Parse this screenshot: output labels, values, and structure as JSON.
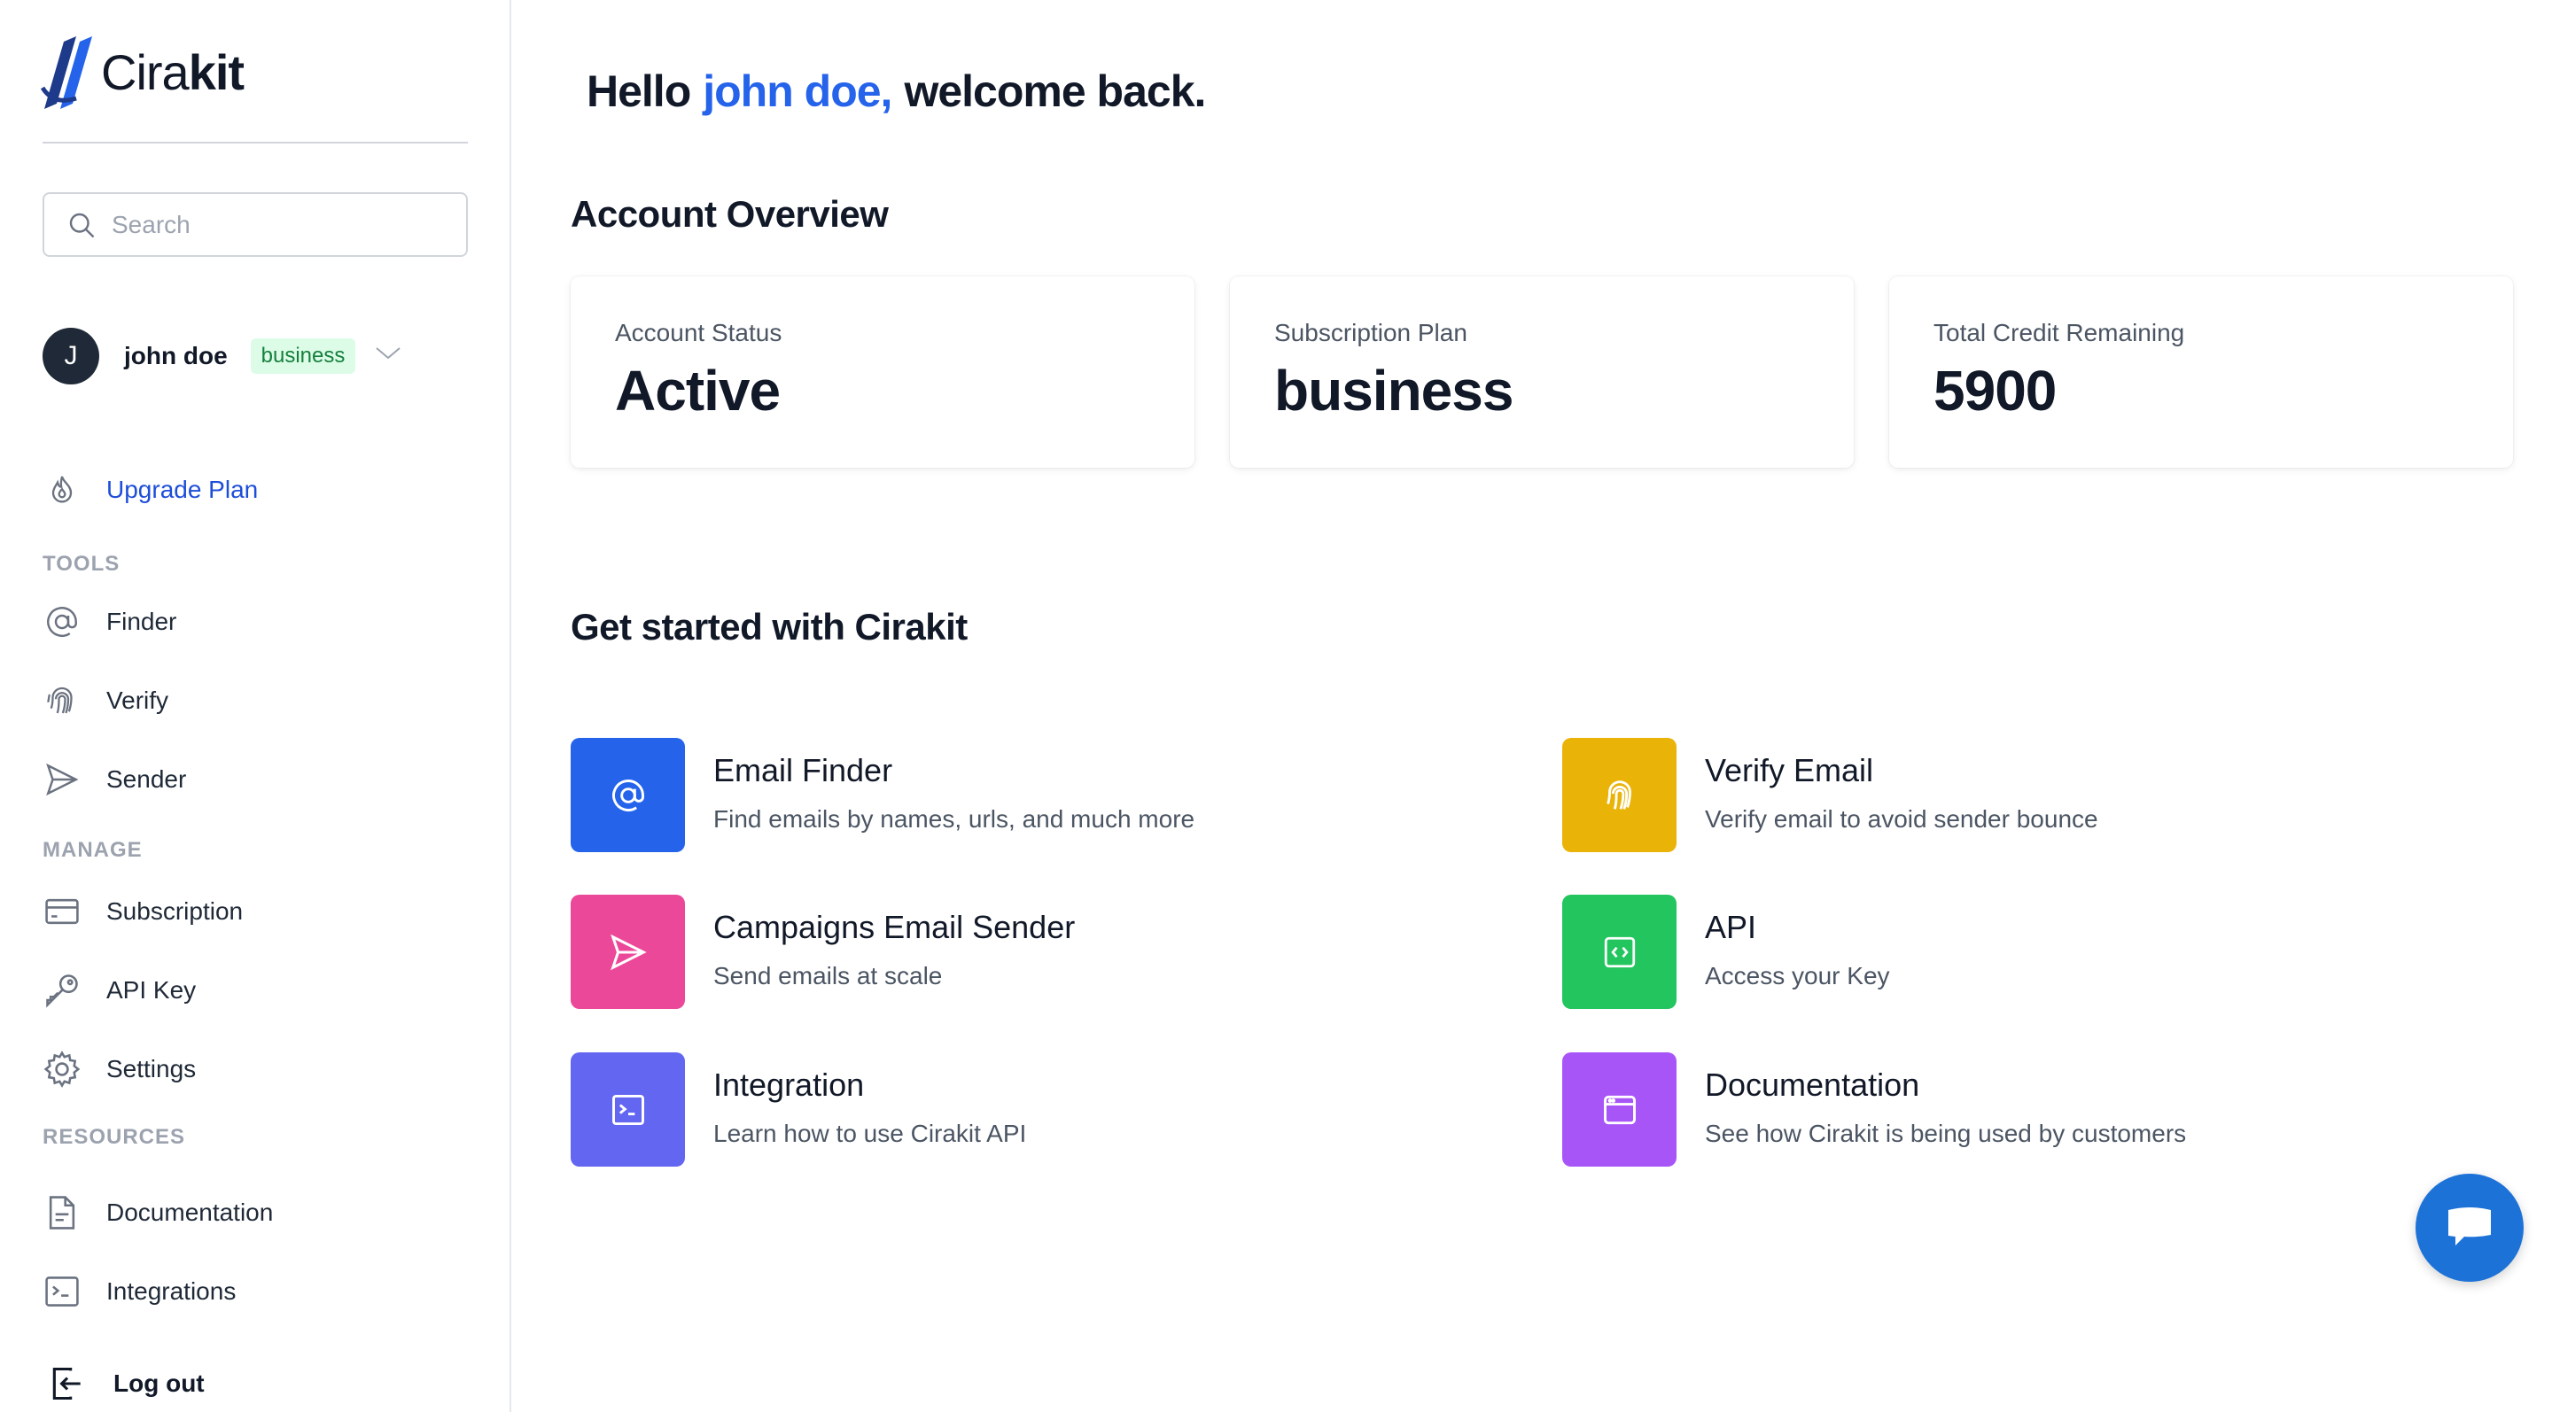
{
  "brand": {
    "name_light": "Cira",
    "name_bold": "kit",
    "accent": "#1e3a8a"
  },
  "search": {
    "placeholder": "Search",
    "value": ""
  },
  "user": {
    "initial": "J",
    "name": "john doe",
    "plan": "business"
  },
  "sidebar": {
    "upgrade": "Upgrade Plan",
    "sections": {
      "tools": "TOOLS",
      "manage": "MANAGE",
      "resources": "RESOURCES"
    },
    "tools": [
      "Finder",
      "Verify",
      "Sender"
    ],
    "manage": [
      "Subscription",
      "API Key",
      "Settings"
    ],
    "resources": [
      "Documentation",
      "Integrations"
    ],
    "logout": "Log out"
  },
  "greeting": {
    "prefix": "Hello",
    "name": "john doe,",
    "suffix": "welcome back."
  },
  "overview": {
    "title": "Account Overview",
    "cards": [
      {
        "label": "Account Status",
        "value": "Active"
      },
      {
        "label": "Subscription Plan",
        "value": "business"
      },
      {
        "label": "Total Credit Remaining",
        "value": "5900"
      }
    ]
  },
  "get_started": {
    "title": "Get started with Cirakit",
    "features": [
      {
        "title": "Email Finder",
        "desc": "Find emails by names, urls, and much more",
        "icon": "at-icon",
        "color": "#2563eb"
      },
      {
        "title": "Verify Email",
        "desc": "Verify email to avoid sender bounce",
        "icon": "fingerprint-icon",
        "color": "#eab308"
      },
      {
        "title": "Campaigns Email Sender",
        "desc": "Send emails at scale",
        "icon": "send-icon",
        "color": "#ec4899"
      },
      {
        "title": "API",
        "desc": "Access your Key",
        "icon": "code-icon",
        "color": "#22c55e"
      },
      {
        "title": "Integration",
        "desc": "Learn how to use Cirakit API",
        "icon": "terminal-icon",
        "color": "#6366f1"
      },
      {
        "title": "Documentation",
        "desc": "See how Cirakit is being used by customers",
        "icon": "browser-window-icon",
        "color": "#a855f7"
      }
    ]
  },
  "chat": {
    "icon": "chat-bubble-icon",
    "color": "#1d72d8"
  }
}
